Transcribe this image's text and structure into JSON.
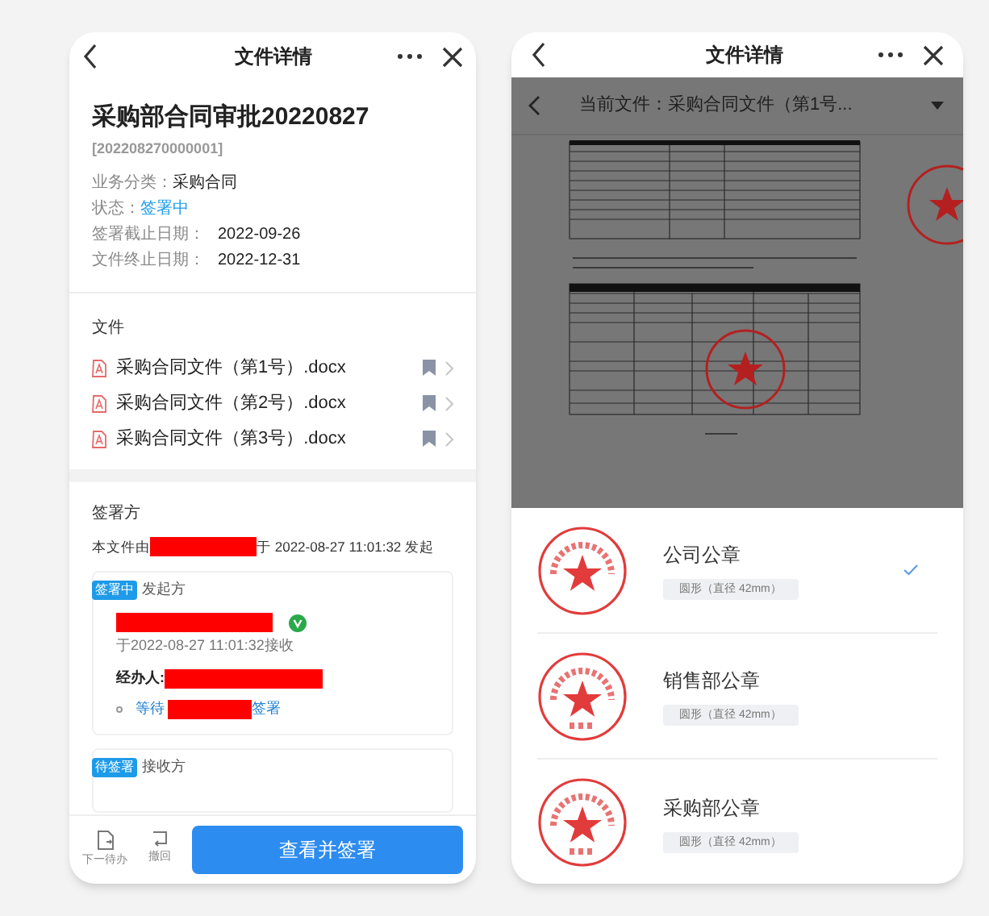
{
  "left_screen": {
    "header": {
      "title": "文件详情"
    },
    "document": {
      "title": "采购部合同审批20220827",
      "code": "[202208270000001]"
    },
    "fields": [
      {
        "label": "业务分类：",
        "value": "采购合同",
        "kind": "text"
      },
      {
        "label": "状态：",
        "value": "签署中",
        "kind": "status"
      },
      {
        "label": "签署截止日期：",
        "value": "2022-09-26",
        "kind": "date"
      },
      {
        "label": "文件终止日期：",
        "value": "2022-12-31",
        "kind": "date"
      }
    ],
    "files_section": {
      "title": "文件",
      "files": [
        {
          "name": "采购合同文件（第1号）.docx"
        },
        {
          "name": "采购合同文件（第2号）.docx"
        },
        {
          "name": "采购合同文件（第3号）.docx"
        }
      ]
    },
    "signers": {
      "title": "签署方",
      "initiated_prefix": "本文件由",
      "initiated_suffix": "于 2022-08-27 11:01:32 发起",
      "parties": [
        {
          "badge": "签署中",
          "role": "发起方",
          "verified": true,
          "received": "于2022-08-27 11:01:32接收",
          "handler_label": "经办人:",
          "waiting_prefix": "等待",
          "waiting_suffix": "签署"
        },
        {
          "badge": "待签署",
          "role": "接收方"
        }
      ]
    },
    "footer": {
      "actions": [
        {
          "label": "下一待办",
          "kind": "next"
        },
        {
          "label": "撤回",
          "kind": "undo"
        }
      ],
      "primary": "查看并签署"
    }
  },
  "right_screen": {
    "header": {
      "title": "文件详情"
    },
    "preview": {
      "title": "当前文件：采购合同文件（第1号..."
    },
    "seals": [
      {
        "name": "公司公章",
        "spec": "圆形（直径 42mm）",
        "selected": true
      },
      {
        "name": "销售部公章",
        "spec": "圆形（直径 42mm）",
        "selected": false
      },
      {
        "name": "采购部公章",
        "spec": "圆形（直径 42mm）",
        "selected": false
      }
    ]
  }
}
